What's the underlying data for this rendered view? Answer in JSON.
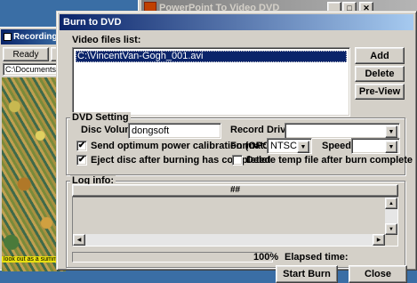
{
  "back_window": {
    "title": "PowerPoint To Video DVD",
    "minimize": "_",
    "maximize": "□",
    "close": "✕"
  },
  "left_window": {
    "title": "Recording PPT",
    "status_ready": "Ready",
    "status_f": "F",
    "path": "C:\\Documents and",
    "caption": "look out as a summ"
  },
  "dialog": {
    "title": "Burn to DVD",
    "video_files_label": "Video files list:",
    "video_files": [
      "C:\\VincentVan-Gogh_001.avi"
    ],
    "add_label": "Add",
    "delete_label": "Delete",
    "preview_label": "Pre-View",
    "dvd_setting_label": "DVD Setting",
    "disc_volume_label": "Disc Volum:",
    "disc_volume_value": "dongsoft",
    "record_driver_label": "Record Driver:",
    "record_driver_value": "",
    "opc_label": "Send optimum power calibration (OPC)",
    "opc_checked": true,
    "format_label": "Format:",
    "format_value": "NTSC",
    "speed_label": "Speed:",
    "speed_value": "",
    "eject_label": "Eject disc after burning has completed",
    "eject_checked": true,
    "delete_temp_label": "Delete temp file after burn complete",
    "delete_temp_checked": false,
    "log_info_label": "Log info:",
    "log_header": "##",
    "progress_percent_text": "100%",
    "progress_fraction": 1.0,
    "elapsed_label": "Elapsed time:",
    "start_burn_label": "Start Burn",
    "close_label": "Close"
  },
  "icons": {
    "check": "✔",
    "dropdown": "▼",
    "up": "▲",
    "down": "▼",
    "left": "◀",
    "right": "▶"
  }
}
